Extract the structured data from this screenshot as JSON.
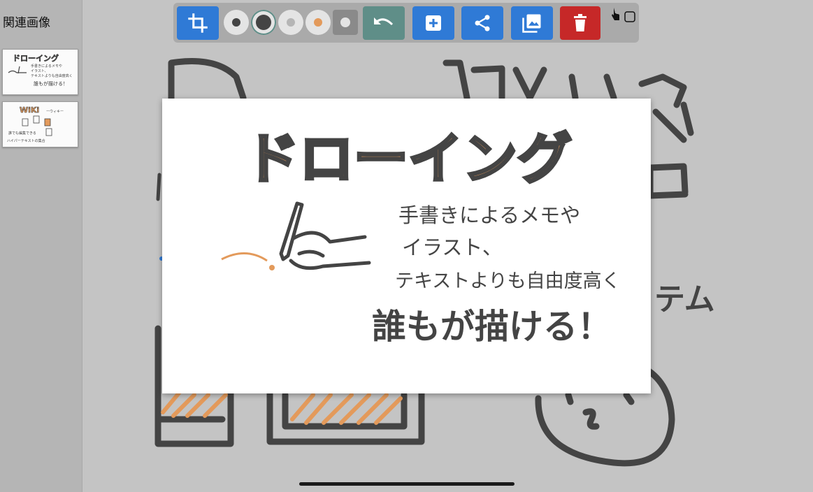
{
  "sidebar": {
    "title": "関連画像",
    "thumbnails": [
      {
        "name": "thumbnail-drawing",
        "text_title": "ドローイング",
        "text_line1": "手書きによるメモや",
        "text_line2": "イラスト、",
        "text_line3": "テキストよりも自由度高く",
        "text_line4": "誰もが描ける！"
      },
      {
        "name": "thumbnail-wiki",
        "text_title": "WiKi",
        "text_title_suffix": "ーウィキー",
        "text_line1": "誰でも編集できる",
        "text_line2": "ハイパーテキストの集合"
      }
    ]
  },
  "toolbar": {
    "buttons": [
      {
        "name": "crop-button",
        "icon": "crop-icon",
        "color": "#2f7ad6"
      },
      {
        "name": "pen-size-small",
        "dot_color": "#444444",
        "selected": false
      },
      {
        "name": "pen-size-large",
        "dot_color": "#444444",
        "selected": true
      },
      {
        "name": "pen-color-gray",
        "dot_color": "#b5b5b5",
        "selected": false
      },
      {
        "name": "pen-color-orange",
        "dot_color": "#e39a5b",
        "selected": false
      },
      {
        "name": "pen-color-dark-gray",
        "dot_color": "#8a8a8a",
        "selected": false
      },
      {
        "name": "undo-button",
        "icon": "undo-icon",
        "color": "#5f8e88"
      },
      {
        "name": "add-button",
        "icon": "plus-box-icon",
        "color": "#2f7ad6"
      },
      {
        "name": "share-button",
        "icon": "share-icon",
        "color": "#2f7ad6"
      },
      {
        "name": "image-button",
        "icon": "image-icon",
        "color": "#2f7ad6"
      },
      {
        "name": "delete-button",
        "icon": "trash-icon",
        "color": "#c62828"
      }
    ],
    "pointer_indicator_icon": "hand-pointer-icon"
  },
  "preview": {
    "title_text": "ドローイング",
    "line1": "手書きによるメモや",
    "line2": "イラスト、",
    "line3": "テキストよりも自由度高く",
    "line4": "誰もが描ける！"
  },
  "canvas_background": {
    "visible_text": "テム"
  },
  "colors": {
    "accent_blue": "#2f7ad6",
    "undo_teal": "#5f8e88",
    "danger_red": "#c62828",
    "drawing_orange": "#e39a5b",
    "drawing_ink": "#444444"
  }
}
